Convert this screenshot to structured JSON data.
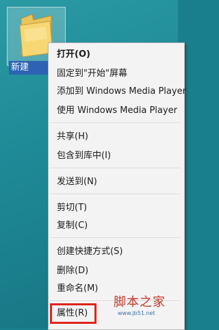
{
  "desktop": {
    "folder_label": "新建"
  },
  "menu": {
    "items": {
      "open": "打开(O)",
      "pin_start": "固定到\"开始\"屏幕",
      "add_wmp": "添加到 Windows Media Player",
      "play_wmp": "使用 Windows Media Player",
      "share": "共享(H)",
      "include_library": "包含到库中(I)",
      "send_to": "发送到(N)",
      "cut": "剪切(T)",
      "copy": "复制(C)",
      "create_shortcut": "创建快捷方式(S)",
      "delete": "删除(D)",
      "rename": "重命名(M)",
      "properties": "属性(R)"
    }
  },
  "watermark": {
    "title": "脚本之家",
    "url": "www.jb51.net"
  },
  "colors": {
    "desktop_bg": "#1f8a97",
    "menu_bg": "#f3f3f3",
    "highlight": "#e1231c",
    "selection": "#2e63b3"
  }
}
